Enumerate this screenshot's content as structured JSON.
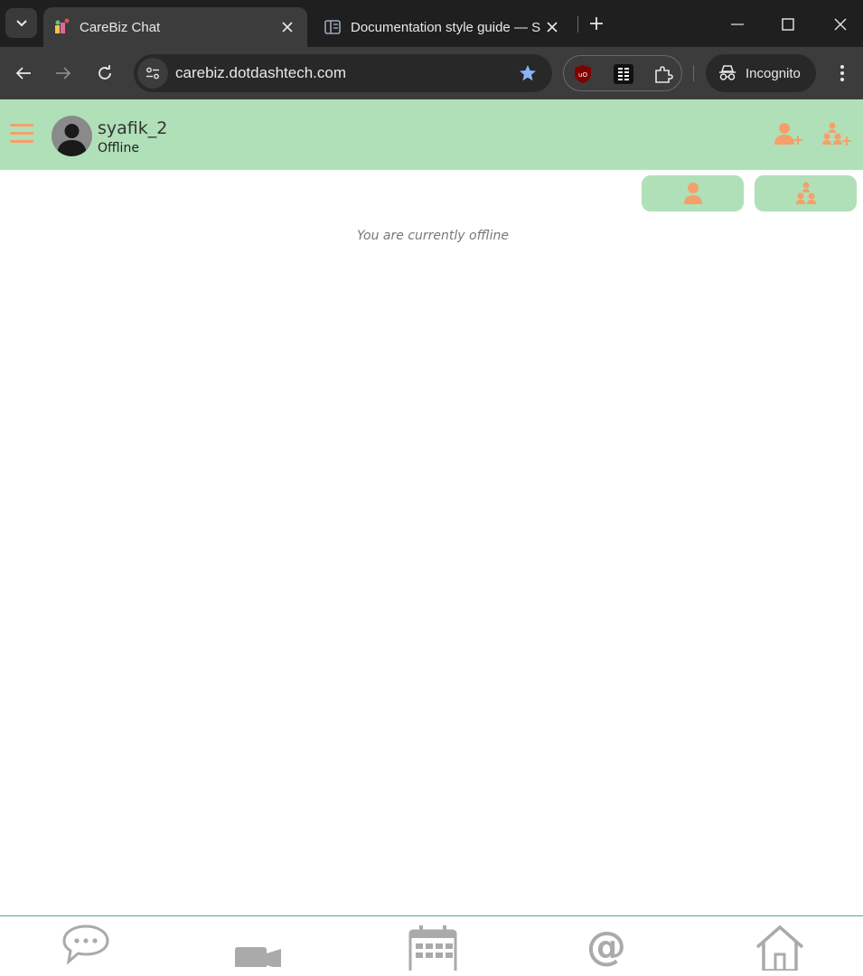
{
  "browser": {
    "tabs": [
      {
        "title": "CareBiz Chat",
        "active": true
      },
      {
        "title": "Documentation style guide — S",
        "active": false
      }
    ],
    "url": "carebiz.dotdashtech.com",
    "profile_label": "Incognito"
  },
  "header": {
    "username": "syafik_2",
    "status": "Offline"
  },
  "main": {
    "offline_message": "You are currently offline"
  },
  "bottom_nav": {
    "items": [
      "chat-icon",
      "video-icon",
      "calendar-icon",
      "at-icon",
      "home-icon"
    ]
  },
  "colors": {
    "header_bg": "#b0e0b8",
    "accent": "#f5a06a",
    "nav_icon": "#aaaaaa"
  }
}
